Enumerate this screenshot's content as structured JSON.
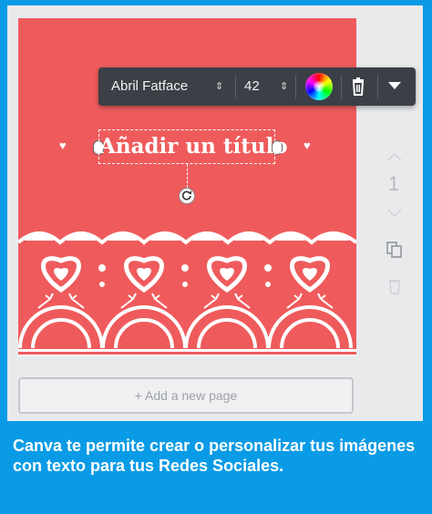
{
  "toolbar": {
    "font_name": "Abril Fatface",
    "font_size": "42",
    "updown_glyph": "⇕",
    "color_picker_icon": "color-wheel-icon",
    "delete_icon": "trash-icon",
    "more_icon": "chevron-down-icon"
  },
  "page": {
    "background_color": "#ef5b5c",
    "title_text": "Añadir un título",
    "heart_glyph": "♥"
  },
  "side_panel": {
    "page_number": "1"
  },
  "add_page_label": "+ Add a new page",
  "caption": "Canva te permite crear o personalizar tus imágenes con texto para tus Redes Sociales."
}
